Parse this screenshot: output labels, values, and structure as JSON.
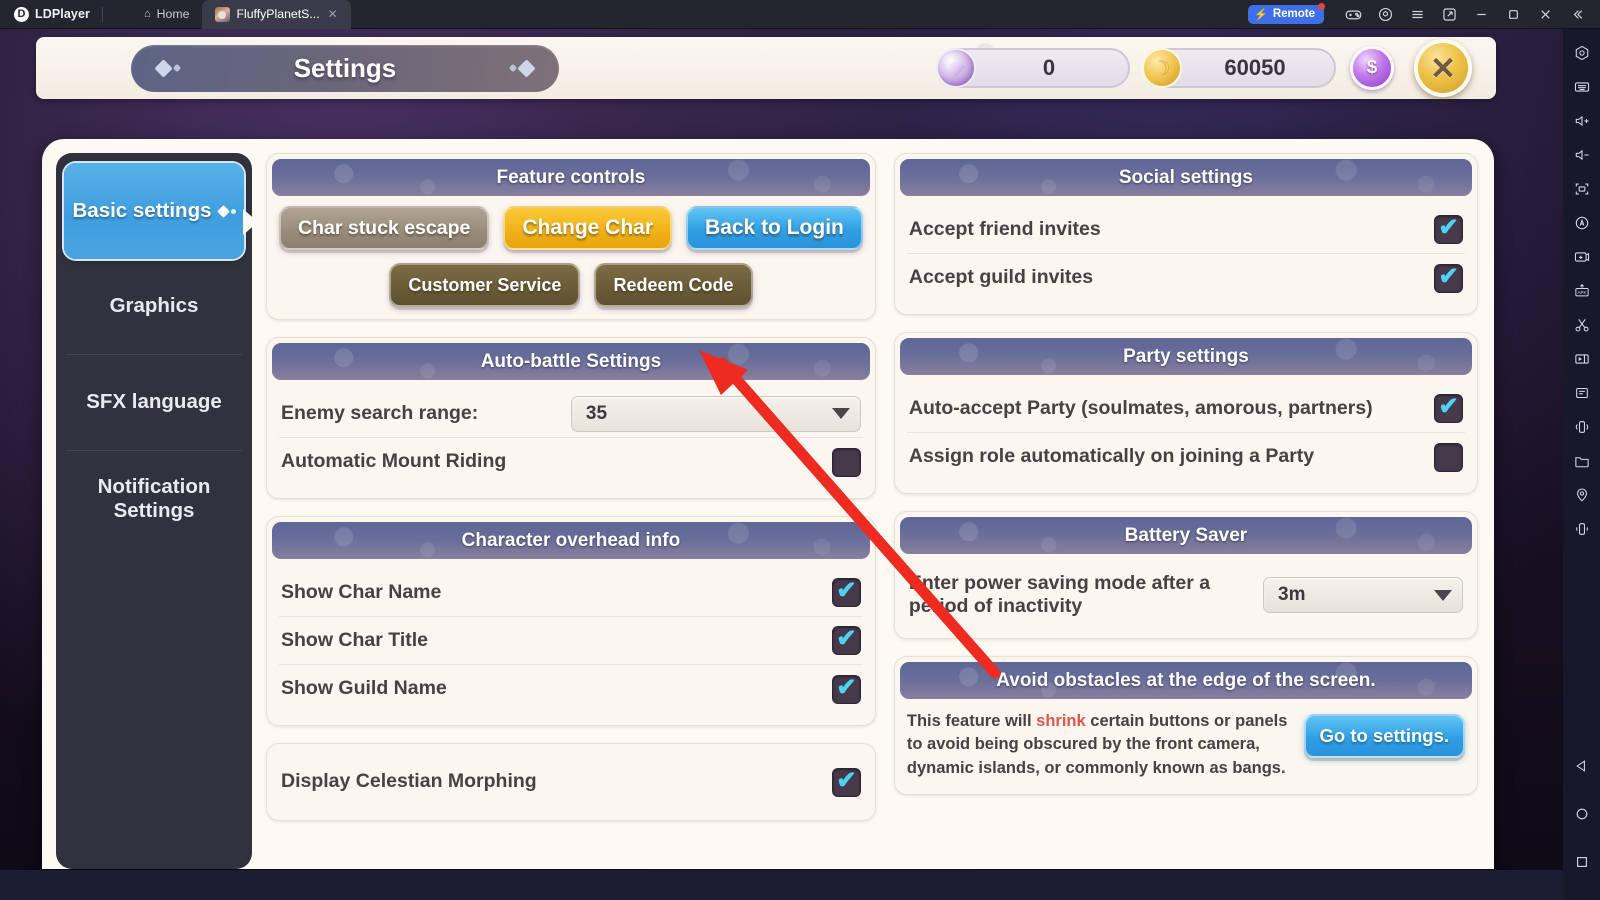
{
  "titlebar": {
    "brand": "LDPlayer",
    "brand_mark": "D",
    "home_tab": "Home",
    "game_tab": "FluffyPlanetS...",
    "tab_close": "✕",
    "remote_label": "Remote",
    "icons": [
      "gamepad-icon",
      "record-icon",
      "menu-icon",
      "multi-instance-icon",
      "minimize-icon",
      "maximize-icon",
      "close-icon",
      "collapse-icon"
    ]
  },
  "vtoolbar": {
    "icons": [
      "hexagon-icon",
      "keyboard-icon",
      "volume-up-icon",
      "volume-down-icon",
      "fullscreen-icon",
      "auto-rotate-icon",
      "screenshot-icon",
      "apk-install-icon",
      "scissors-icon",
      "video-record-icon",
      "notes-icon",
      "shake-icon",
      "folder-icon",
      "location-icon",
      "vibrate-icon"
    ],
    "nav": [
      "back-icon",
      "home-icon",
      "recents-icon"
    ]
  },
  "game_header": {
    "title": "Settings",
    "gem_value": "0",
    "coin_value": "60050",
    "shop_symbol": "$",
    "close_symbol": "✕"
  },
  "sidebar": {
    "items": [
      {
        "label": "Basic settings",
        "active": true
      },
      {
        "label": "Graphics",
        "active": false
      },
      {
        "label": "SFX language",
        "active": false
      },
      {
        "label": "Notification Settings",
        "active": false
      }
    ]
  },
  "panels": {
    "feature_controls": {
      "title": "Feature controls",
      "buttons_row1": [
        {
          "label": "Char stuck escape",
          "style": "grey"
        },
        {
          "label": "Change Char",
          "style": "gold"
        },
        {
          "label": "Back to Login",
          "style": "blue"
        }
      ],
      "buttons_row2": [
        {
          "label": "Customer Service",
          "style": "brown"
        },
        {
          "label": "Redeem Code",
          "style": "brown"
        }
      ]
    },
    "auto_battle": {
      "title": "Auto-battle Settings",
      "enemy_range_label": "Enemy search range:",
      "enemy_range_value": "35",
      "mount_label": "Automatic Mount Riding",
      "mount_checked": false
    },
    "overhead_info": {
      "title": "Character overhead info",
      "rows": [
        {
          "label": "Show Char Name",
          "checked": true
        },
        {
          "label": "Show Char Title",
          "checked": true
        },
        {
          "label": "Show Guild Name",
          "checked": true
        }
      ]
    },
    "celestian": {
      "label": "Display Celestian Morphing",
      "checked": true
    },
    "social": {
      "title": "Social settings",
      "rows": [
        {
          "label": "Accept friend invites",
          "checked": true
        },
        {
          "label": "Accept guild invites",
          "checked": true
        }
      ]
    },
    "party": {
      "title": "Party settings",
      "rows": [
        {
          "label": "Auto-accept Party (soulmates, amorous, partners)",
          "checked": true
        },
        {
          "label": "Assign role automatically on joining a Party",
          "checked": false
        }
      ]
    },
    "battery": {
      "title": "Battery Saver",
      "label": "Enter power saving mode after a period of inactivity",
      "value": "3m"
    },
    "avoid_obstacles": {
      "title": "Avoid obstacles at the edge of the screen.",
      "text_before": "This feature will ",
      "highlight": "shrink",
      "text_after": " certain buttons or panels to avoid being obscured by the front camera, dynamic islands, or commonly known as bangs.",
      "button": "Go to settings."
    }
  },
  "colors": {
    "accent_blue": "#2f9fe4",
    "accent_gold": "#f1b21a",
    "check_cyan": "#4ed2f5",
    "panel_header": "#6a6f9a",
    "annotation_red": "#ee2b21",
    "highlight_red": "#e2554f"
  }
}
